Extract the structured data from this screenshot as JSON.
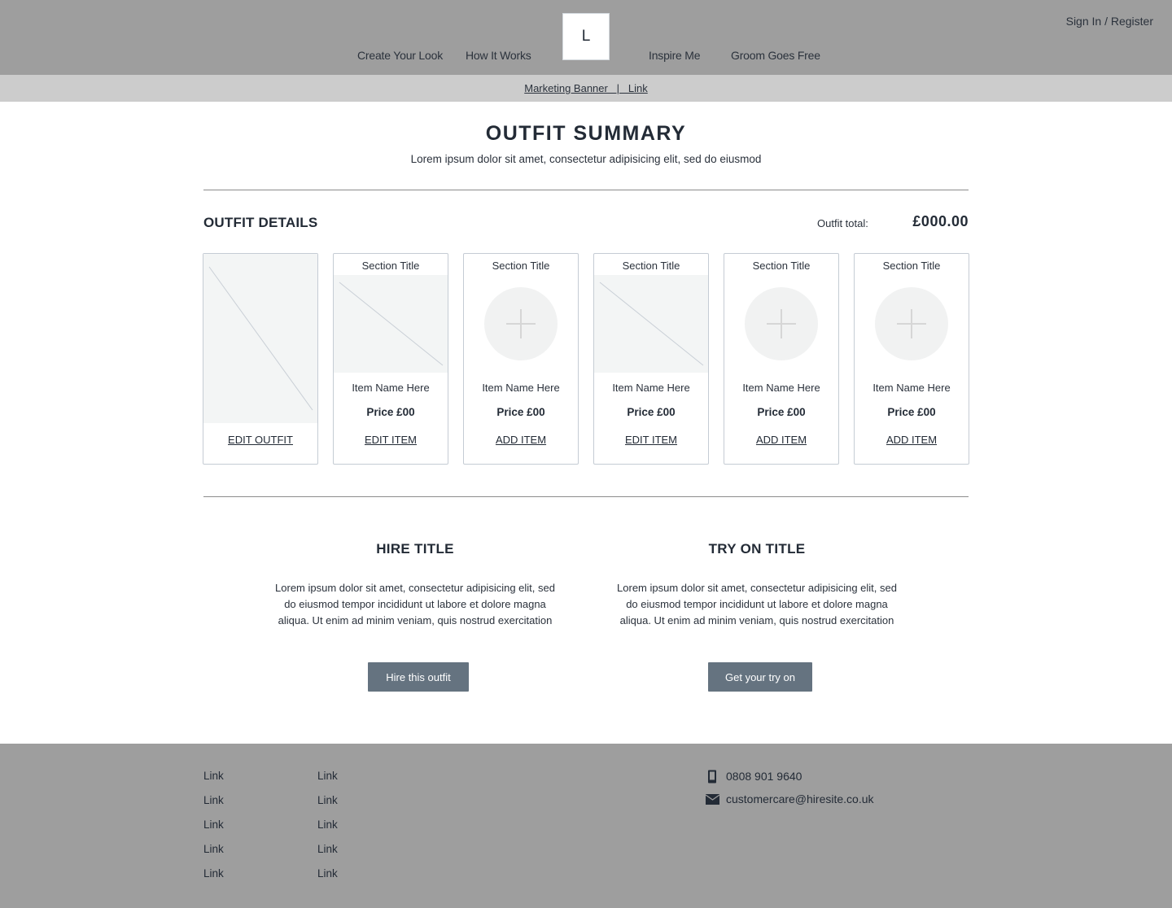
{
  "header": {
    "logo_text": "L",
    "nav_left": [
      {
        "label": "Create Your Look"
      },
      {
        "label": "How It Works"
      }
    ],
    "nav_right": [
      {
        "label": "Inspire Me"
      },
      {
        "label": "Groom Goes Free"
      }
    ],
    "sign_in_label": "Sign In / Register"
  },
  "banner": {
    "text": "Marketing Banner   |   Link"
  },
  "summary": {
    "title": "OUTFIT SUMMARY",
    "subtitle": "Lorem ipsum dolor sit amet, consectetur adipisicing elit, sed do eiusmod"
  },
  "details": {
    "title": "OUTFIT DETAILS",
    "total_label": "Outfit total:",
    "total_value": "£000.00"
  },
  "outfit_card": {
    "image_icon": "image-placeholder-icon",
    "action_label": "EDIT OUTFIT"
  },
  "item_cards": [
    {
      "section_title": "Section Title",
      "state": "filled",
      "item_name": "Item Name Here",
      "price": "Price £00",
      "action_label": "EDIT ITEM"
    },
    {
      "section_title": "Section Title",
      "state": "empty",
      "item_name": "Item Name Here",
      "price": "Price £00",
      "action_label": "ADD ITEM"
    },
    {
      "section_title": "Section Title",
      "state": "filled",
      "item_name": "Item Name Here",
      "price": "Price £00",
      "action_label": "EDIT ITEM"
    },
    {
      "section_title": "Section Title",
      "state": "empty",
      "item_name": "Item Name Here",
      "price": "Price £00",
      "action_label": "ADD ITEM"
    },
    {
      "section_title": "Section Title",
      "state": "empty",
      "item_name": "Item Name Here",
      "price": "Price £00",
      "action_label": "ADD ITEM"
    }
  ],
  "hire": {
    "title": "HIRE TITLE",
    "text": "Lorem ipsum dolor sit amet, consectetur adipisicing elit, sed do eiusmod tempor incididunt ut labore et dolore magna aliqua. Ut enim ad minim veniam, quis nostrud exercitation",
    "button_label": "Hire this outfit"
  },
  "try_on": {
    "title": "TRY ON TITLE",
    "text": "Lorem ipsum dolor sit amet, consectetur adipisicing elit, sed do eiusmod tempor incididunt ut labore et dolore magna aliqua. Ut enim ad minim veniam, quis nostrud exercitation",
    "button_label": "Get your try on"
  },
  "footer": {
    "links_col1": [
      "Link",
      "Link",
      "Link",
      "Link",
      "Link"
    ],
    "links_col2": [
      "Link",
      "Link",
      "Link",
      "Link",
      "Link"
    ],
    "phone": {
      "icon": "phone-icon",
      "text": "0808 901 9640"
    },
    "email": {
      "icon": "mail-icon",
      "text": "customercare@hiresite.co.uk"
    }
  },
  "colors": {
    "header_bg": "#9e9e9e",
    "banner_bg": "#cccccc",
    "button_bg": "#657380",
    "text_dark": "#232b36",
    "placeholder_bg": "#f3f5f5"
  }
}
